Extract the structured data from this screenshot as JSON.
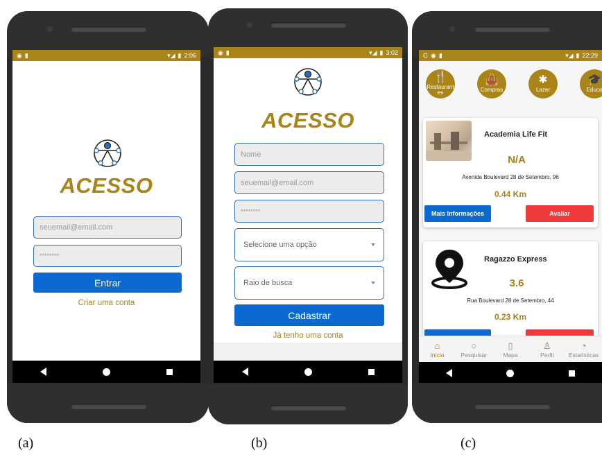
{
  "screens": {
    "a": {
      "status_time": "2:06",
      "brand": "ACESSO",
      "email_placeholder": "seuemail@email.com",
      "password_placeholder": "********",
      "login_button": "Entrar",
      "create_account_link": "Criar uma conta"
    },
    "b": {
      "status_time": "3:02",
      "brand": "ACESSO",
      "name_placeholder": "Nome",
      "email_placeholder": "seuemail@email.com",
      "password_placeholder": "********",
      "select_placeholder": "Selecione uma opção",
      "radius_placeholder": "Raio de busca",
      "register_button": "Cadastrar",
      "have_account_link": "Já tenho uma conta"
    },
    "c": {
      "status_time": "22:29",
      "categories": [
        {
          "label": "Restaurantes",
          "icon": "fork-knife-icon"
        },
        {
          "label": "Compras",
          "icon": "shopping-bag-icon"
        },
        {
          "label": "Lazer",
          "icon": "person-icon"
        },
        {
          "label": "Educa",
          "icon": "graduation-cap-icon"
        }
      ],
      "places": [
        {
          "name": "Academia Life Fit",
          "rating": "N/A",
          "address": "Avenida Boulevard 28 de Setembro, 96",
          "distance": "0.44 Km"
        },
        {
          "name": "Ragazzo Express",
          "rating": "3.6",
          "address": "Rua Boulevard 28 de Setembro, 44",
          "distance": "0.23 Km"
        }
      ],
      "info_button": "Mais Informações",
      "rate_button": "Avaliar",
      "tabs": [
        {
          "label": "Início",
          "icon": "home-icon"
        },
        {
          "label": "Pesquisar",
          "icon": "search-icon"
        },
        {
          "label": "Mapa",
          "icon": "map-icon"
        },
        {
          "label": "Perfil",
          "icon": "user-icon"
        },
        {
          "label": "Estatísticas",
          "icon": "pie-chart-icon"
        }
      ]
    }
  },
  "captions": [
    "(a)",
    "(b)",
    "(c)"
  ],
  "colors": {
    "accent_gold": "#a88419",
    "primary_blue": "#0b6ad0",
    "danger_red": "#ef3b3b",
    "field_border": "#2b6fb5"
  }
}
